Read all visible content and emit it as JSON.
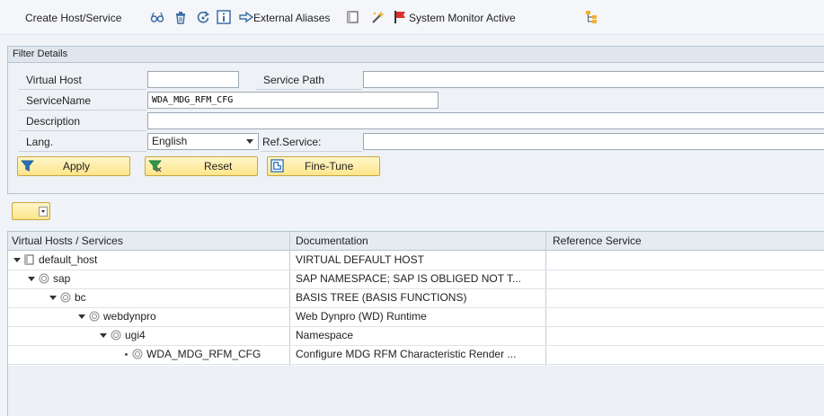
{
  "toolbar": {
    "create_label": "Create Host/Service",
    "external_aliases_label": "External Aliases",
    "system_monitor_label": "System Monitor Active",
    "icons": [
      "glasses-icon",
      "trash-icon",
      "refresh-icon",
      "info-icon",
      "arrow-right-icon",
      "document-icon",
      "magic-wand-icon",
      "flag-icon",
      "hierarchy-icon"
    ]
  },
  "filter": {
    "title": "Filter Details",
    "virtual_host_label": "Virtual Host",
    "virtual_host_value": "",
    "service_path_label": "Service Path",
    "service_path_value": "",
    "service_name_label": "ServiceName",
    "service_name_value": "WDA_MDG_RFM_CFG",
    "description_label": "Description",
    "description_value": "",
    "lang_label": "Lang.",
    "lang_value": "English",
    "ref_service_label": "Ref.Service:",
    "ref_service_value": "",
    "apply_label": "Apply",
    "reset_label": "Reset",
    "finetune_label": "Fine-Tune"
  },
  "tree": {
    "columns": [
      "Virtual Hosts / Services",
      "Documentation",
      "Reference Service"
    ],
    "rows": [
      {
        "name": "default_host",
        "doc": "VIRTUAL DEFAULT HOST"
      },
      {
        "name": "sap",
        "doc": "SAP NAMESPACE; SAP IS OBLIGED NOT T..."
      },
      {
        "name": "bc",
        "doc": "BASIS TREE (BASIS FUNCTIONS)"
      },
      {
        "name": "webdynpro",
        "doc": "Web Dynpro (WD) Runtime"
      },
      {
        "name": "ugi4",
        "doc": "Namespace"
      },
      {
        "name": "WDA_MDG_RFM_CFG",
        "doc": "Configure MDG RFM Characteristic Render ..."
      }
    ]
  },
  "colors": {
    "accent_button": "#fde58a",
    "panel_bg": "#eef2f6",
    "header_bg": "#e6ebf1"
  }
}
